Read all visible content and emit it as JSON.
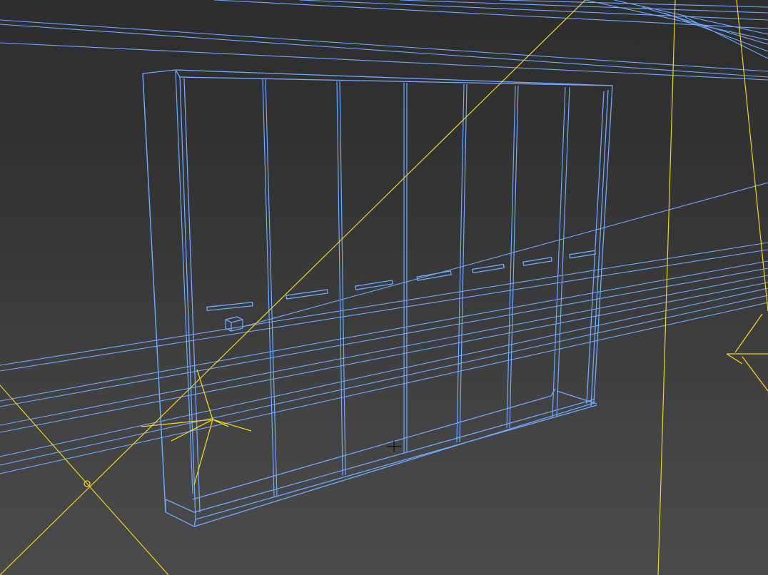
{
  "viewport": {
    "mode": "wireframe",
    "colors": {
      "background_top": "#2d2d2d",
      "background_bottom": "#4a4a4a",
      "object_wire": "#6ea8ff",
      "light_wire": "#f2d21b",
      "cursor": "#111111"
    }
  },
  "scene": {
    "objects": [
      "wardrobe",
      "spot-lights",
      "light-gizmos"
    ],
    "wardrobe": {
      "door_count": 7,
      "handle_count": 7,
      "knob_count": 1
    },
    "light_gizmos": 2
  }
}
